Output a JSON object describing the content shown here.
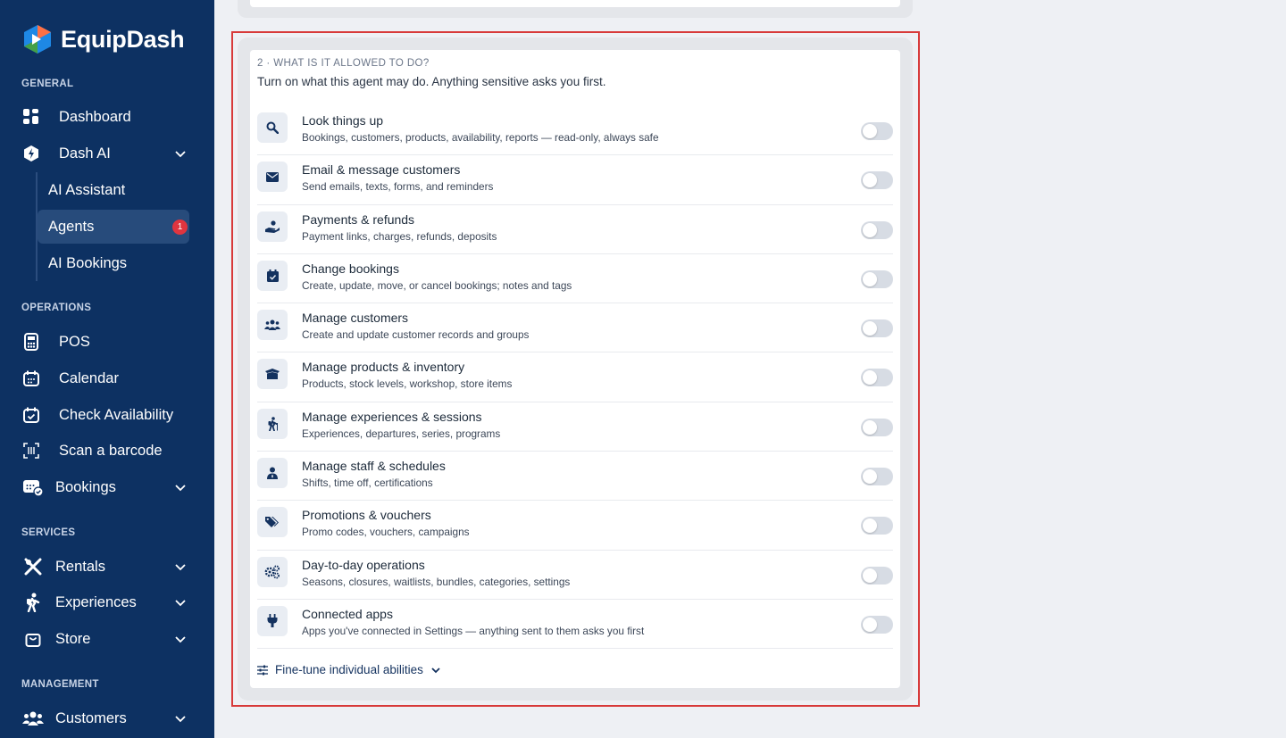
{
  "brand": {
    "name": "EquipDash"
  },
  "sidebar": {
    "sections": {
      "general": "GENERAL",
      "operations": "OPERATIONS",
      "services": "SERVICES",
      "management": "MANAGEMENT"
    },
    "items": {
      "dashboard": "Dashboard",
      "dash_ai": "Dash AI",
      "ai_assistant": "AI Assistant",
      "agents": "Agents",
      "agents_badge": "1",
      "ai_bookings": "AI Bookings",
      "pos": "POS",
      "calendar": "Calendar",
      "check_availability": "Check Availability",
      "scan_barcode": "Scan a barcode",
      "bookings": "Bookings",
      "rentals": "Rentals",
      "experiences": "Experiences",
      "store": "Store",
      "customers": "Customers"
    }
  },
  "permissions_card": {
    "step_label": "2 · WHAT IS IT ALLOWED TO DO?",
    "description": "Turn on what this agent may do. Anything sensitive asks you first.",
    "items": [
      {
        "icon": "search-icon",
        "title": "Look things up",
        "subtitle": "Bookings, customers, products, availability, reports — read-only, always safe",
        "enabled": false
      },
      {
        "icon": "envelope-icon",
        "title": "Email & message customers",
        "subtitle": "Send emails, texts, forms, and reminders",
        "enabled": false
      },
      {
        "icon": "hand-coin-icon",
        "title": "Payments & refunds",
        "subtitle": "Payment links, charges, refunds, deposits",
        "enabled": false
      },
      {
        "icon": "calendar-check-icon",
        "title": "Change bookings",
        "subtitle": "Create, update, move, or cancel bookings; notes and tags",
        "enabled": false
      },
      {
        "icon": "users-icon",
        "title": "Manage customers",
        "subtitle": "Create and update customer records and groups",
        "enabled": false
      },
      {
        "icon": "box-icon",
        "title": "Manage products & inventory",
        "subtitle": "Products, stock levels, workshop, store items",
        "enabled": false
      },
      {
        "icon": "hiker-icon",
        "title": "Manage experiences & sessions",
        "subtitle": "Experiences, departures, series, programs",
        "enabled": false
      },
      {
        "icon": "staff-icon",
        "title": "Manage staff & schedules",
        "subtitle": "Shifts, time off, certifications",
        "enabled": false
      },
      {
        "icon": "tags-icon",
        "title": "Promotions & vouchers",
        "subtitle": "Promo codes, vouchers, campaigns",
        "enabled": false
      },
      {
        "icon": "gears-icon",
        "title": "Day-to-day operations",
        "subtitle": "Seasons, closures, waitlists, bundles, categories, settings",
        "enabled": false
      },
      {
        "icon": "plug-icon",
        "title": "Connected apps",
        "subtitle": "Apps you've connected in Settings — anything sent to them asks you first",
        "enabled": false
      }
    ],
    "finetune_label": "Fine-tune individual abilities"
  }
}
